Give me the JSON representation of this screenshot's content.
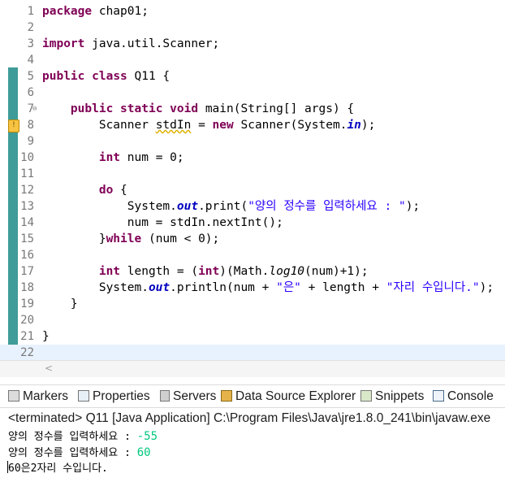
{
  "editor": {
    "lines": [
      {
        "n": "1",
        "html": "<span class=\"kw\">package</span> chap01;"
      },
      {
        "n": "2",
        "html": ""
      },
      {
        "n": "3",
        "html": "<span class=\"kw\">import</span> java.util.Scanner;"
      },
      {
        "n": "4",
        "html": ""
      },
      {
        "n": "5",
        "html": "<span class=\"kw\">public</span> <span class=\"kw\">class</span> Q11 {"
      },
      {
        "n": "6",
        "html": ""
      },
      {
        "n": "7",
        "html": "    <span class=\"kw\">public</span> <span class=\"kw\">static</span> <span class=\"kw\">void</span> main(String[] args) {"
      },
      {
        "n": "8",
        "html": "        Scanner <span class=\"warnvar\">stdIn</span> = <span class=\"kw\">new</span> Scanner(System.<span class=\"fld\">in</span>);"
      },
      {
        "n": "9",
        "html": ""
      },
      {
        "n": "10",
        "html": "        <span class=\"kw\">int</span> num = 0;"
      },
      {
        "n": "11",
        "html": ""
      },
      {
        "n": "12",
        "html": "        <span class=\"kw\">do</span> {"
      },
      {
        "n": "13",
        "html": "            System.<span class=\"fld\">out</span>.print(<span class=\"str\">\"양의 정수를 입력하세요 : \"</span>);"
      },
      {
        "n": "14",
        "html": "            num = stdIn.nextInt();"
      },
      {
        "n": "15",
        "html": "        }<span class=\"kw\">while</span> (num &lt; 0);"
      },
      {
        "n": "16",
        "html": ""
      },
      {
        "n": "17",
        "html": "        <span class=\"kw\">int</span> length = (<span class=\"kw\">int</span>)(Math.<span class=\"ital\">log10</span>(num)+1);"
      },
      {
        "n": "18",
        "html": "        System.<span class=\"fld\">out</span>.println(num + <span class=\"str\">\"은\"</span> + length + <span class=\"str\">\"자리 수입니다.\"</span>);"
      },
      {
        "n": "19",
        "html": "    }"
      },
      {
        "n": "20",
        "html": ""
      },
      {
        "n": "21",
        "html": "}"
      },
      {
        "n": "22",
        "html": ""
      }
    ]
  },
  "tabs": {
    "markers": "Markers",
    "properties": "Properties",
    "servers": "Servers",
    "data_source_explorer": "Data Source Explorer",
    "snippets": "Snippets",
    "console": "Console"
  },
  "console": {
    "header": "<terminated> Q11 [Java Application] C:\\Program Files\\Java\\jre1.8.0_241\\bin\\javaw.exe",
    "prompt1": "양의 정수를 입력하세요 : ",
    "input1": "-55",
    "prompt2": "양의 정수를 입력하세요 : ",
    "input2": "60",
    "result": "60은2자리 수입니다."
  },
  "colors": {
    "keyword": "#7f0055",
    "string": "#2a00ff",
    "field": "#0000c0",
    "console_input": "#00c87d",
    "change_bar": "#3f9c98"
  }
}
